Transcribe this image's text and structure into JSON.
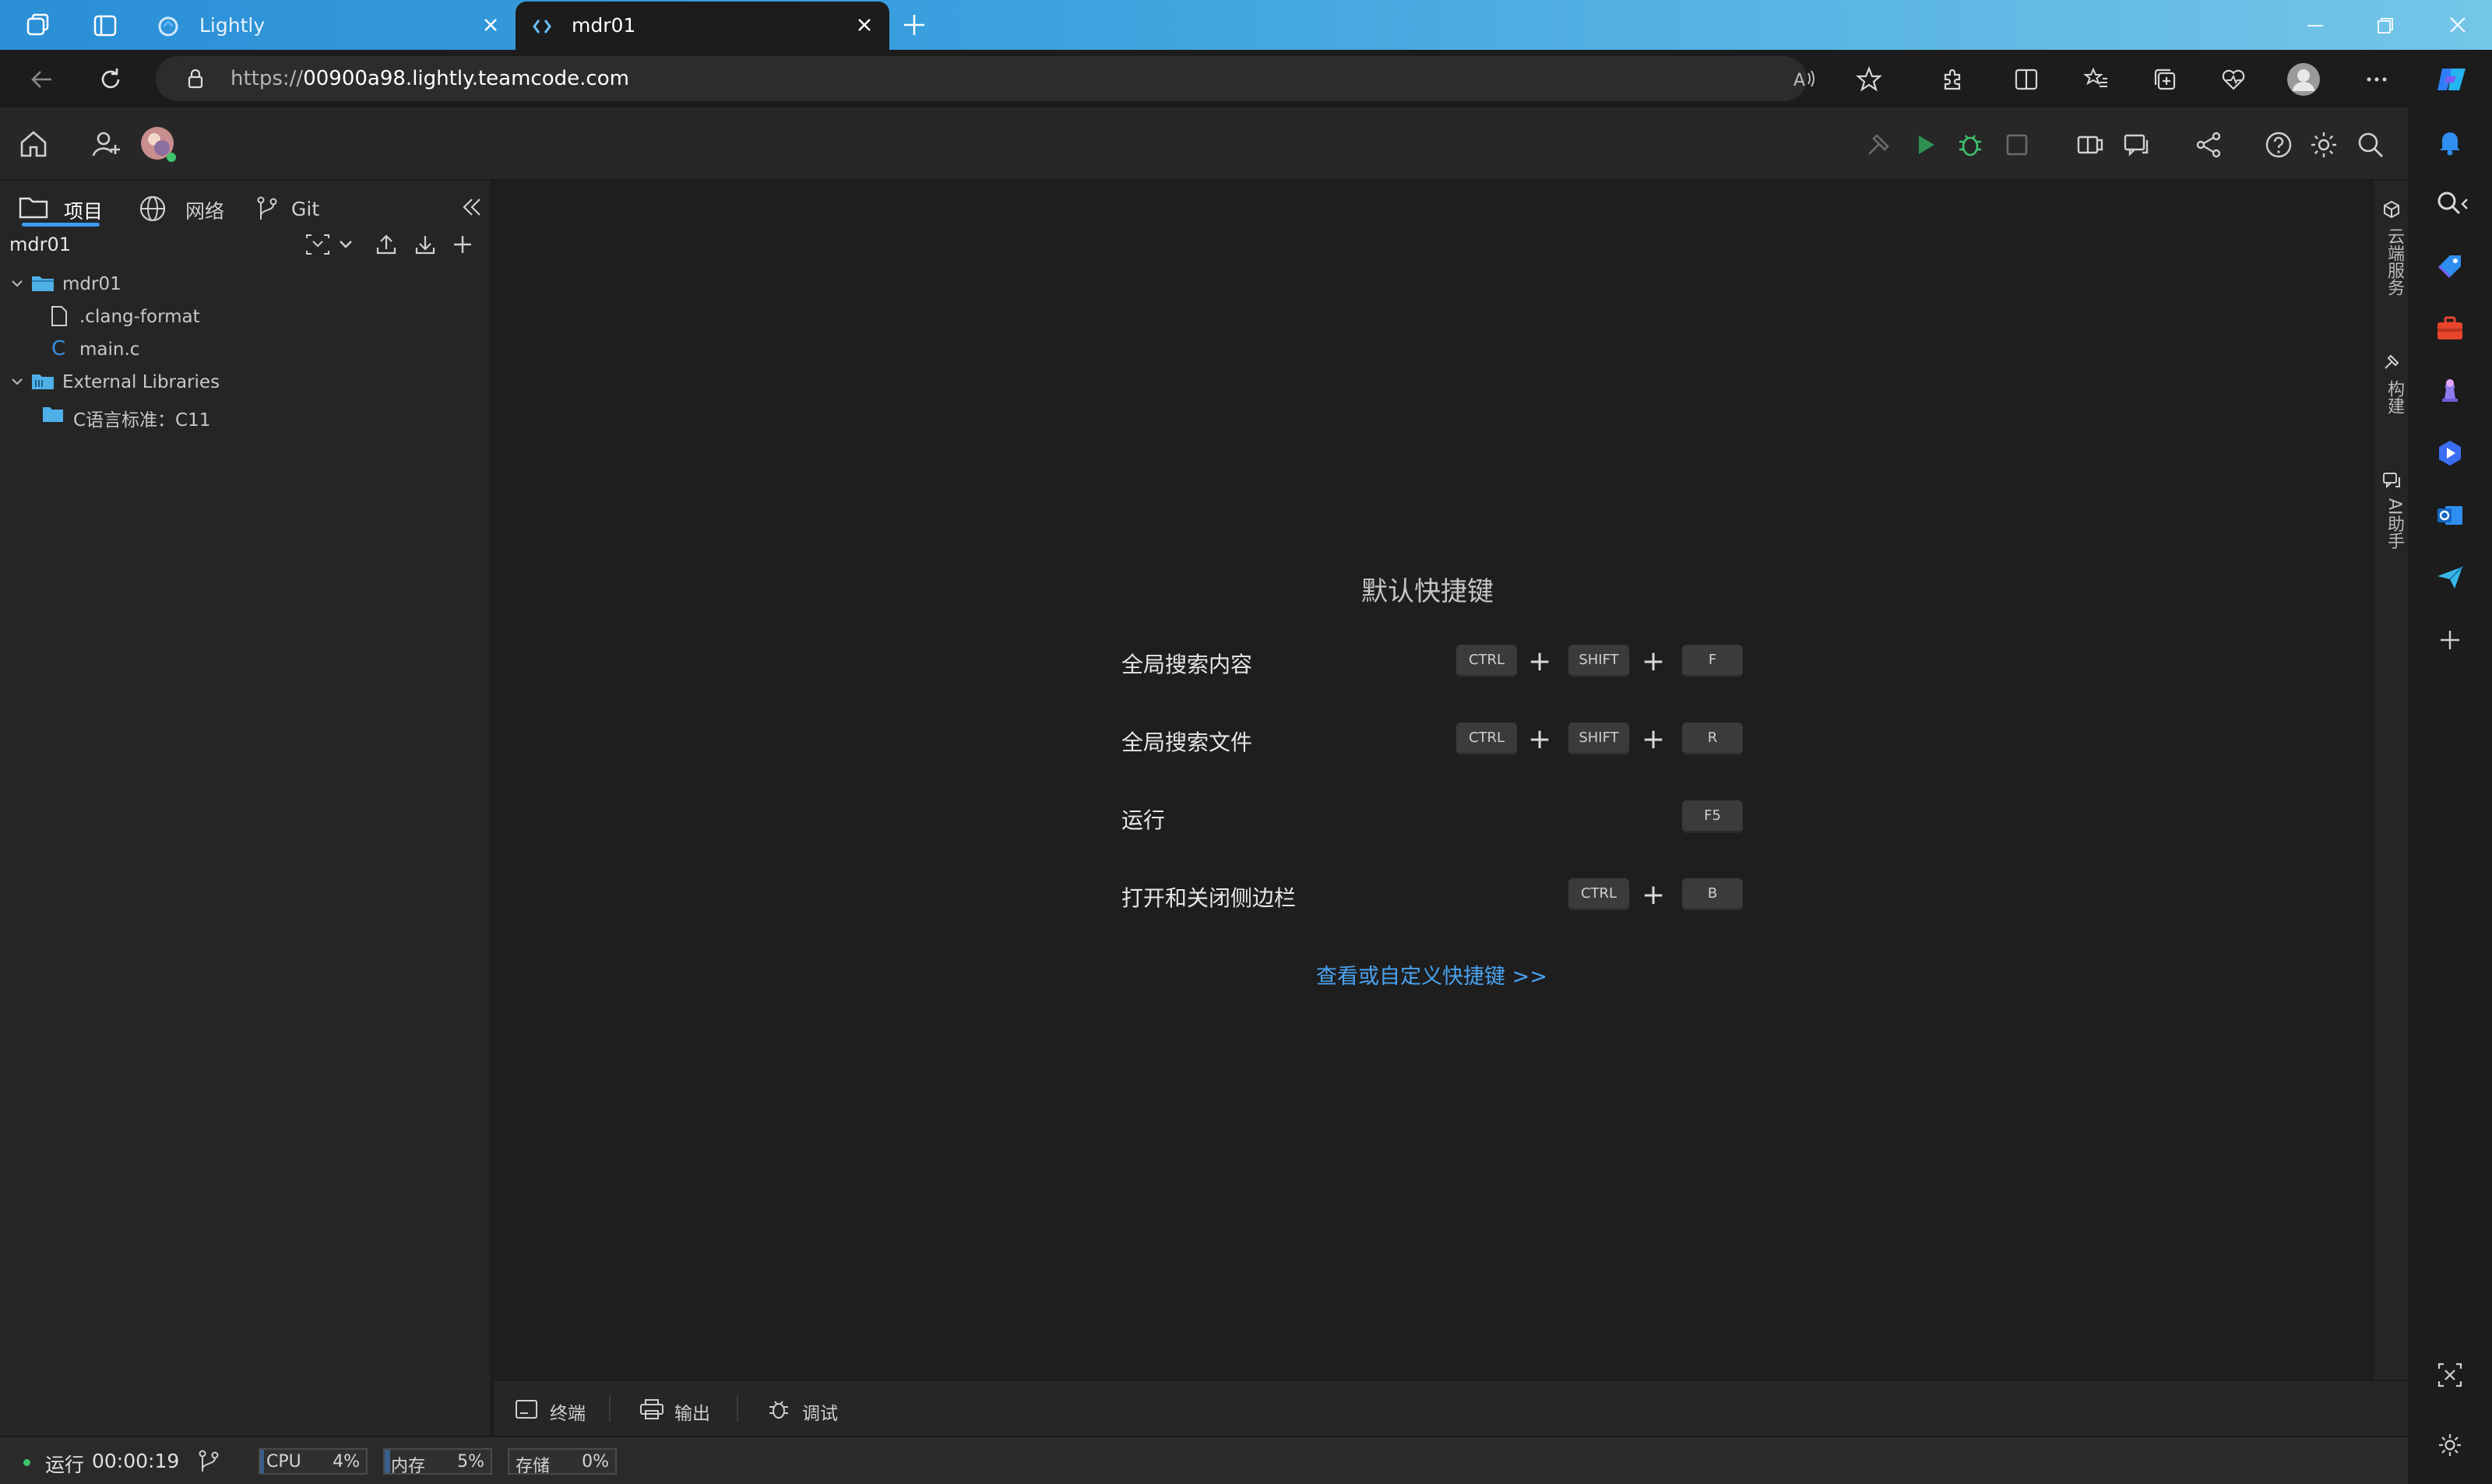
{
  "browser": {
    "tabs": [
      {
        "label": "Lightly"
      },
      {
        "label": "mdr01"
      }
    ],
    "url_prefix": "https://",
    "url_host": "00900a98.lightly.teamcode.com"
  },
  "sidebar": {
    "tabs": [
      {
        "label": "项目"
      },
      {
        "label": "网络"
      },
      {
        "label": "Git"
      }
    ],
    "project_name": "mdr01",
    "tree": [
      {
        "label": "mdr01"
      },
      {
        "label": ".clang-format"
      },
      {
        "label": "main.c"
      },
      {
        "label": "External Libraries"
      },
      {
        "label": "C语言标准：C11"
      }
    ]
  },
  "shortcuts": {
    "title": "默认快捷键",
    "items": [
      {
        "label": "全局搜索内容",
        "keys": [
          "CTRL",
          "SHIFT",
          "F"
        ]
      },
      {
        "label": "全局搜索文件",
        "keys": [
          "CTRL",
          "SHIFT",
          "R"
        ]
      },
      {
        "label": "运行",
        "keys": [
          "F5"
        ]
      },
      {
        "label": "打开和关闭侧边栏",
        "keys": [
          "CTRL",
          "B"
        ]
      }
    ],
    "customize_link": "查看或自定义快捷键 >>"
  },
  "right_panel": {
    "items": [
      {
        "label": "云端服务"
      },
      {
        "label": "构建"
      },
      {
        "label": "AI助手"
      }
    ]
  },
  "bottom_tabs": [
    {
      "label": "终端"
    },
    {
      "label": "输出"
    },
    {
      "label": "调试"
    }
  ],
  "status": {
    "run_label": "运行",
    "run_time": "00:00:19",
    "cpu_label": "CPU",
    "cpu_value": "4%",
    "mem_label": "内存",
    "mem_value": "5%",
    "storage_label": "存储",
    "storage_value": "0%",
    "cpu_fraction": 0.04,
    "mem_fraction": 0.05,
    "storage_fraction": 0.0
  },
  "colors": {
    "accent": "#3b9cf0",
    "link": "#4aa3f0",
    "run_green": "#3ec46d",
    "folder_blue": "#4fb0e8"
  }
}
